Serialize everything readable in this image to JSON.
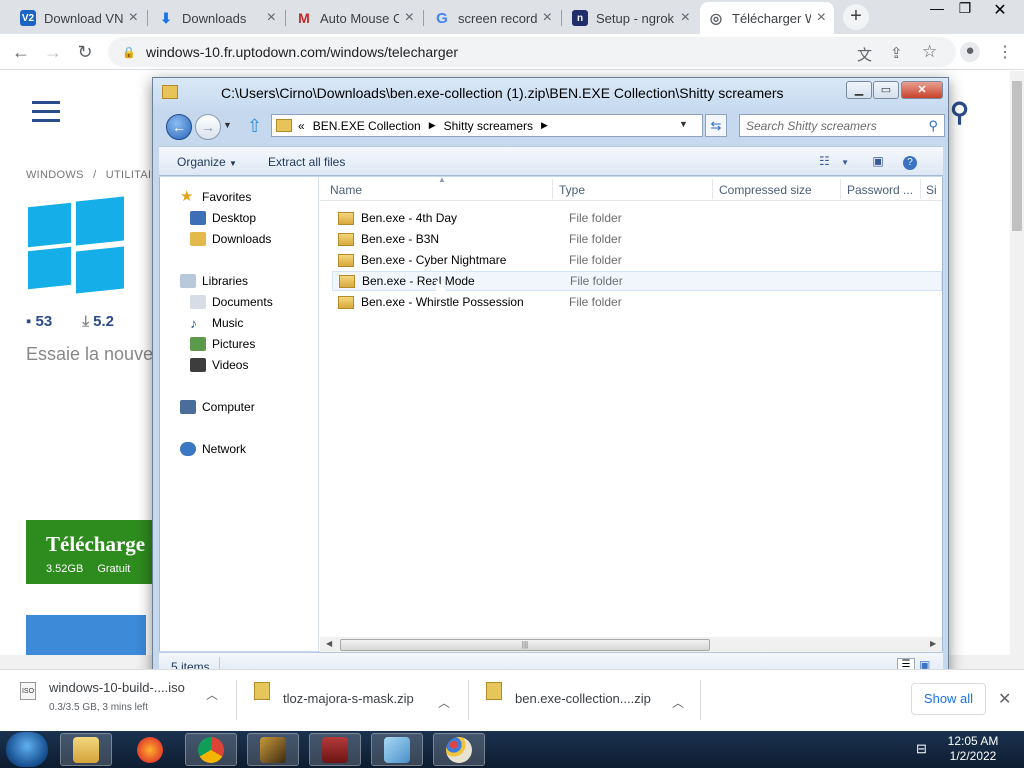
{
  "browser": {
    "tabs": [
      {
        "title": "Download VNC",
        "icon": "vnc-icon",
        "color": "#1b64c4",
        "glyph": "V2"
      },
      {
        "title": "Downloads",
        "icon": "download-icon",
        "color": "#1a73e8",
        "glyph": "⬇"
      },
      {
        "title": "Auto Mouse C",
        "icon": "mg-icon",
        "color": "#c62828",
        "glyph": "M"
      },
      {
        "title": "screen recordi",
        "icon": "google-icon",
        "color": "#4285f4",
        "glyph": "G"
      },
      {
        "title": "Setup - ngrok",
        "icon": "ngrok-icon",
        "color": "#1f2d6b",
        "glyph": "n"
      },
      {
        "title": "Télécharger W",
        "icon": "globe-icon",
        "color": "#5f6368",
        "glyph": "◎"
      }
    ],
    "url": "windows-10.fr.uptodown.com/windows/telecharger"
  },
  "webpage": {
    "crumb1": "WINDOWS",
    "crumb_sep": "/",
    "crumb2": "UTILITAIRE",
    "comments": "53",
    "downloads": "5.2",
    "tagline": "Essaie la nouve",
    "download_label": "Télécharge",
    "download_size": "3.52GB",
    "download_price": "Gratuit"
  },
  "explorer": {
    "title": "C:\\Users\\Cirno\\Downloads\\ben.exe-collection (1).zip\\BEN.EXE Collection\\Shitty screamers",
    "address_overflow": "«",
    "breadcrumb": [
      "BEN.EXE Collection",
      "Shitty screamers"
    ],
    "search_placeholder": "Search Shitty screamers",
    "organize": "Organize",
    "extract": "Extract all files",
    "nav": {
      "favorites": "Favorites",
      "desktop": "Desktop",
      "downloads": "Downloads",
      "libraries": "Libraries",
      "documents": "Documents",
      "music": "Music",
      "pictures": "Pictures",
      "videos": "Videos",
      "computer": "Computer",
      "network": "Network"
    },
    "columns": [
      "Name",
      "Type",
      "Compressed size",
      "Password ...",
      "Si"
    ],
    "files": [
      {
        "name": "Ben.exe - 4th Day",
        "type": "File folder"
      },
      {
        "name": "Ben.exe - B3N",
        "type": "File folder"
      },
      {
        "name": "Ben.exe - Cyber Nightmare",
        "type": "File folder"
      },
      {
        "name": "Ben.exe - Real Mode",
        "type": "File folder"
      },
      {
        "name": "Ben.exe - Whirstle Possession",
        "type": "File folder"
      }
    ],
    "status": "5 items"
  },
  "downloads_bar": {
    "items": [
      {
        "name": "windows-10-build-....iso",
        "sub": "0.3/3.5 GB, 3 mins left"
      },
      {
        "name": "tloz-majora-s-mask.zip"
      },
      {
        "name": "ben.exe-collection....zip"
      }
    ],
    "show_all": "Show all"
  },
  "taskbar": {
    "time": "12:05 AM",
    "date": "1/2/2022"
  }
}
